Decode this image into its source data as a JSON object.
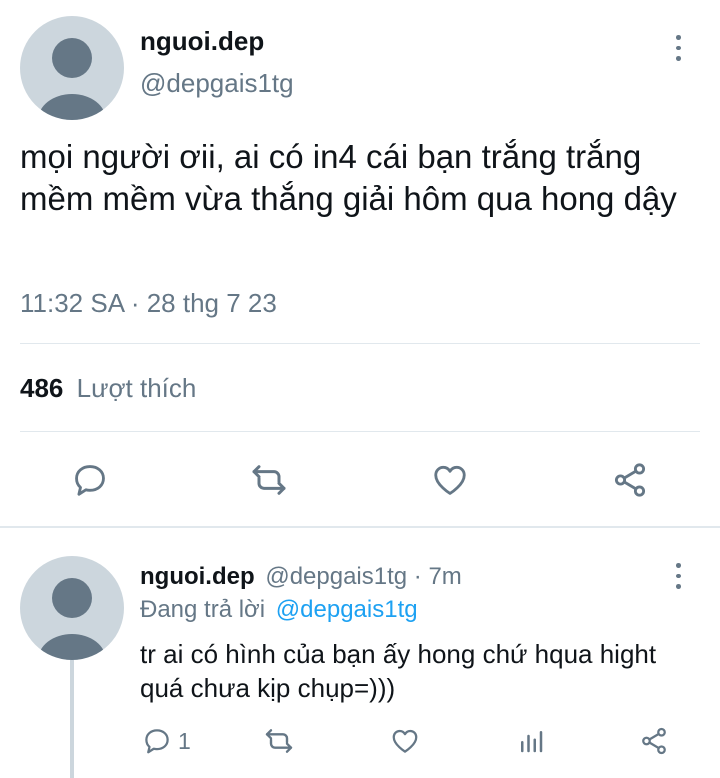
{
  "tweet": {
    "display_name": "nguoi.dep",
    "handle": "@depgais1tg",
    "text": "mọi người ơii, ai có in4 cái bạn trắng trắng mềm mềm vừa thắng giải hôm qua hong dậy",
    "timestamp": "11:32 SA · 28 thg 7 23",
    "likes_count": "486",
    "likes_label": "Lượt thích",
    "actions": [
      "reply-icon",
      "retweet-icon",
      "like-icon",
      "share-icon"
    ]
  },
  "reply": {
    "display_name": "nguoi.dep",
    "meta": "@depgais1tg · 7m",
    "replying_prefix": "Đang trả lời",
    "replying_to": "@depgais1tg",
    "text": "tr ai có hình của bạn ấy hong chứ hqua hight quá chưa kịp chụp=)))",
    "reply_count": "1",
    "actions": [
      "reply-icon",
      "retweet-icon",
      "like-icon",
      "analytics-icon",
      "share-icon"
    ]
  },
  "colors": {
    "accent": "#1da1f2",
    "muted": "#657786",
    "divider": "#e1e8ed",
    "avatar": "#ccd6dd",
    "avatar_figure": "#657786"
  }
}
